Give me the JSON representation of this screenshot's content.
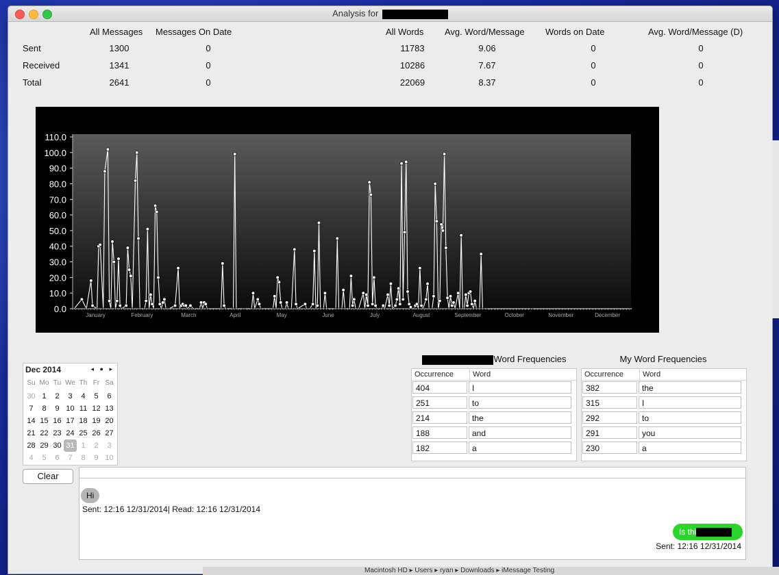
{
  "window": {
    "title": "Analysis for"
  },
  "stats": {
    "headers": {
      "all_messages": "All Messages",
      "messages_on_date": "Messages On Date",
      "all_words": "All Words",
      "avg_word_message": "Avg. Word/Message",
      "words_on_date": "Words on Date",
      "avg_word_message_d": "Avg. Word/Message (D)"
    },
    "rows": [
      {
        "label": "Sent",
        "all_messages": "1300",
        "messages_on_date": "0",
        "all_words": "11783",
        "avg": "9.06",
        "words_on_date": "0",
        "avg_d": "0"
      },
      {
        "label": "Received",
        "all_messages": "1341",
        "messages_on_date": "0",
        "all_words": "10286",
        "avg": "7.67",
        "words_on_date": "0",
        "avg_d": "0"
      },
      {
        "label": "Total",
        "all_messages": "2641",
        "messages_on_date": "0",
        "all_words": "22069",
        "avg": "8.37",
        "words_on_date": "0",
        "avg_d": "0"
      }
    ]
  },
  "chart_data": {
    "type": "line",
    "title": "",
    "xlabel": "",
    "ylabel": "",
    "ylim": [
      0,
      110
    ],
    "yticks": [
      "0.0",
      "10.0",
      "20.0",
      "30.0",
      "40.0",
      "50.0",
      "60.0",
      "70.0",
      "80.0",
      "90.0",
      "100.0",
      "110.0"
    ],
    "months": [
      "January",
      "February",
      "March",
      "April",
      "May",
      "June",
      "July",
      "August",
      "September",
      "October",
      "November",
      "December"
    ],
    "x_domain": [
      0,
      365
    ],
    "points": [
      [
        1,
        0
      ],
      [
        6,
        6
      ],
      [
        9,
        0
      ],
      [
        12,
        18
      ],
      [
        13,
        2
      ],
      [
        16,
        0
      ],
      [
        17,
        40
      ],
      [
        18,
        41
      ],
      [
        20,
        0
      ],
      [
        21,
        88
      ],
      [
        23,
        102
      ],
      [
        24,
        5
      ],
      [
        25,
        0
      ],
      [
        26,
        43
      ],
      [
        27,
        30
      ],
      [
        28,
        0
      ],
      [
        29,
        5
      ],
      [
        30,
        32
      ],
      [
        31,
        2
      ],
      [
        32,
        0
      ],
      [
        35,
        2
      ],
      [
        36,
        39
      ],
      [
        37,
        25
      ],
      [
        38,
        21
      ],
      [
        39,
        0
      ],
      [
        41,
        82
      ],
      [
        42,
        100
      ],
      [
        43,
        45
      ],
      [
        44,
        0
      ],
      [
        47,
        0
      ],
      [
        48,
        5
      ],
      [
        49,
        51
      ],
      [
        50,
        0
      ],
      [
        51,
        9
      ],
      [
        52,
        3
      ],
      [
        53,
        0
      ],
      [
        54,
        66
      ],
      [
        55,
        62
      ],
      [
        56,
        20
      ],
      [
        57,
        3
      ],
      [
        58,
        0
      ],
      [
        59,
        4
      ],
      [
        60,
        6
      ],
      [
        61,
        0
      ],
      [
        63,
        0
      ],
      [
        67,
        2
      ],
      [
        69,
        26
      ],
      [
        70,
        0
      ],
      [
        71,
        2
      ],
      [
        72,
        3
      ],
      [
        73,
        2
      ],
      [
        74,
        2
      ],
      [
        75,
        0
      ],
      [
        77,
        2
      ],
      [
        79,
        0
      ],
      [
        83,
        0
      ],
      [
        84,
        4
      ],
      [
        85,
        0
      ],
      [
        86,
        4
      ],
      [
        87,
        3
      ],
      [
        88,
        0
      ],
      [
        97,
        0
      ],
      [
        98,
        29
      ],
      [
        99,
        2
      ],
      [
        100,
        0
      ],
      [
        105,
        0
      ],
      [
        106,
        99
      ],
      [
        107,
        0
      ],
      [
        112,
        0
      ],
      [
        117,
        0
      ],
      [
        118,
        10
      ],
      [
        119,
        0
      ],
      [
        121,
        6
      ],
      [
        122,
        3
      ],
      [
        123,
        0
      ],
      [
        131,
        0
      ],
      [
        132,
        8
      ],
      [
        133,
        0
      ],
      [
        134,
        20
      ],
      [
        135,
        17
      ],
      [
        136,
        4
      ],
      [
        137,
        0
      ],
      [
        139,
        0
      ],
      [
        140,
        4
      ],
      [
        141,
        0
      ],
      [
        143,
        0
      ],
      [
        145,
        38
      ],
      [
        146,
        3
      ],
      [
        147,
        0
      ],
      [
        152,
        3
      ],
      [
        153,
        0
      ],
      [
        155,
        0
      ],
      [
        157,
        3
      ],
      [
        158,
        37
      ],
      [
        159,
        0
      ],
      [
        160,
        2
      ],
      [
        161,
        55
      ],
      [
        162,
        0
      ],
      [
        164,
        0
      ],
      [
        165,
        10
      ],
      [
        166,
        0
      ],
      [
        172,
        0
      ],
      [
        173,
        45
      ],
      [
        174,
        0
      ],
      [
        176,
        0
      ],
      [
        177,
        12
      ],
      [
        178,
        0
      ],
      [
        181,
        0
      ],
      [
        182,
        21
      ],
      [
        183,
        2
      ],
      [
        184,
        6
      ],
      [
        185,
        0
      ],
      [
        187,
        0
      ],
      [
        190,
        10
      ],
      [
        191,
        0
      ],
      [
        192,
        9
      ],
      [
        193,
        2
      ],
      [
        194,
        81
      ],
      [
        195,
        73
      ],
      [
        196,
        3
      ],
      [
        197,
        20
      ],
      [
        198,
        2
      ],
      [
        199,
        0
      ],
      [
        202,
        0
      ],
      [
        203,
        2
      ],
      [
        204,
        0
      ],
      [
        206,
        9
      ],
      [
        207,
        2
      ],
      [
        208,
        16
      ],
      [
        209,
        0
      ],
      [
        211,
        2
      ],
      [
        212,
        6
      ],
      [
        213,
        13
      ],
      [
        214,
        3
      ],
      [
        215,
        93
      ],
      [
        216,
        6
      ],
      [
        217,
        49
      ],
      [
        218,
        94
      ],
      [
        219,
        11
      ],
      [
        220,
        3
      ],
      [
        221,
        1
      ],
      [
        222,
        0
      ],
      [
        223,
        0
      ],
      [
        224,
        2
      ],
      [
        225,
        3
      ],
      [
        226,
        0
      ],
      [
        227,
        26
      ],
      [
        228,
        2
      ],
      [
        229,
        0
      ],
      [
        231,
        6
      ],
      [
        232,
        16
      ],
      [
        233,
        0
      ],
      [
        235,
        0
      ],
      [
        236,
        8
      ],
      [
        237,
        80
      ],
      [
        238,
        56
      ],
      [
        239,
        0
      ],
      [
        240,
        5
      ],
      [
        241,
        54
      ],
      [
        242,
        50
      ],
      [
        243,
        99
      ],
      [
        244,
        39
      ],
      [
        245,
        7
      ],
      [
        246,
        0
      ],
      [
        247,
        8
      ],
      [
        248,
        2
      ],
      [
        249,
        4
      ],
      [
        250,
        0
      ],
      [
        252,
        10
      ],
      [
        253,
        0
      ],
      [
        254,
        47
      ],
      [
        255,
        0
      ],
      [
        256,
        0
      ],
      [
        257,
        9
      ],
      [
        258,
        2
      ],
      [
        259,
        10
      ],
      [
        260,
        11
      ],
      [
        261,
        3
      ],
      [
        262,
        0
      ],
      [
        263,
        5
      ],
      [
        264,
        0
      ],
      [
        266,
        0
      ],
      [
        267,
        35
      ],
      [
        268,
        0
      ],
      [
        270,
        0
      ],
      [
        300,
        0
      ],
      [
        365,
        0
      ]
    ]
  },
  "calendar": {
    "month_label": "Dec 2014",
    "nav": "◂ ● ▸",
    "weekdays": [
      "Su",
      "Mo",
      "Tu",
      "We",
      "Th",
      "Fr",
      "Sa"
    ],
    "weeks": [
      [
        "30",
        "1",
        "2",
        "3",
        "4",
        "5",
        "6"
      ],
      [
        "7",
        "8",
        "9",
        "10",
        "11",
        "12",
        "13"
      ],
      [
        "14",
        "15",
        "16",
        "17",
        "18",
        "19",
        "20"
      ],
      [
        "21",
        "22",
        "23",
        "24",
        "25",
        "26",
        "27"
      ],
      [
        "28",
        "29",
        "30",
        "31",
        "1",
        "2",
        "3"
      ],
      [
        "4",
        "5",
        "6",
        "7",
        "8",
        "9",
        "10"
      ]
    ],
    "selected": "31"
  },
  "their_freq": {
    "title_suffix": "Word Frequencies",
    "col_occurrence": "Occurrence",
    "col_word": "Word",
    "rows": [
      [
        "404",
        "I"
      ],
      [
        "251",
        "to"
      ],
      [
        "214",
        "the"
      ],
      [
        "188",
        "and"
      ],
      [
        "182",
        "a"
      ]
    ]
  },
  "my_freq": {
    "title": "My Word Frequencies",
    "col_occurrence": "Occurrence",
    "col_word": "Word",
    "rows": [
      [
        "382",
        "the"
      ],
      [
        "315",
        "I"
      ],
      [
        "292",
        "to"
      ],
      [
        "291",
        "you"
      ],
      [
        "230",
        "a"
      ]
    ]
  },
  "clear_button": "Clear",
  "messages": {
    "incoming_text": "Hi",
    "incoming_meta": "Sent: 12:16 12/31/2014| Read: 12:16 12/31/2014",
    "outgoing_text": "Is thi",
    "outgoing_meta": "Sent: 12:16 12/31/2014"
  },
  "finder_bar": "Macintosh HD  ▸  Users  ▸  ryan  ▸  Downloads  ▸  iMessage Testing"
}
